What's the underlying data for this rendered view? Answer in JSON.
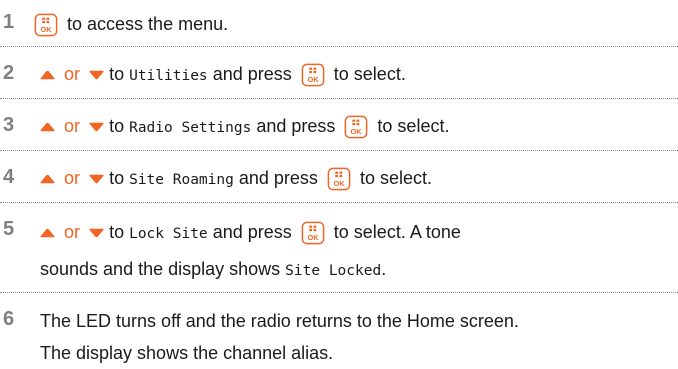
{
  "steps": [
    {
      "number": "1",
      "button_icon": "menu-ok-button-icon",
      "text_after": "to access the menu."
    },
    {
      "number": "2",
      "up_icon": "up-arrow-icon",
      "or": "or",
      "down_icon": "down-arrow-icon",
      "to": "to",
      "menu_item": "Utilities",
      "and_press": "and press",
      "button_icon": "menu-ok-button-icon",
      "to_select": "to select."
    },
    {
      "number": "3",
      "up_icon": "up-arrow-icon",
      "or": "or",
      "down_icon": "down-arrow-icon",
      "to": "to",
      "menu_item": "Radio Settings",
      "and_press": "and press",
      "button_icon": "menu-ok-button-icon",
      "to_select": "to select."
    },
    {
      "number": "4",
      "up_icon": "up-arrow-icon",
      "or": "or",
      "down_icon": "down-arrow-icon",
      "to": "to",
      "menu_item": "Site Roaming",
      "and_press": "and press",
      "button_icon": "menu-ok-button-icon",
      "to_select": "to select."
    },
    {
      "number": "5",
      "up_icon": "up-arrow-icon",
      "or": "or",
      "down_icon": "down-arrow-icon",
      "to": "to",
      "menu_item": "Lock Site",
      "and_press": "and press",
      "button_icon": "menu-ok-button-icon",
      "to_select": "to select. A tone",
      "line2_text": "sounds and the display shows",
      "display_text": "Site Locked",
      "line2_end": "."
    },
    {
      "number": "6",
      "line1": "The LED turns off and the radio returns to the Home screen.",
      "line2": "The display shows the channel alias."
    }
  ],
  "button_label": "OK",
  "colors": {
    "accent": "#f26522",
    "number": "#7f7f7f",
    "divider": "#8c8c8c"
  }
}
